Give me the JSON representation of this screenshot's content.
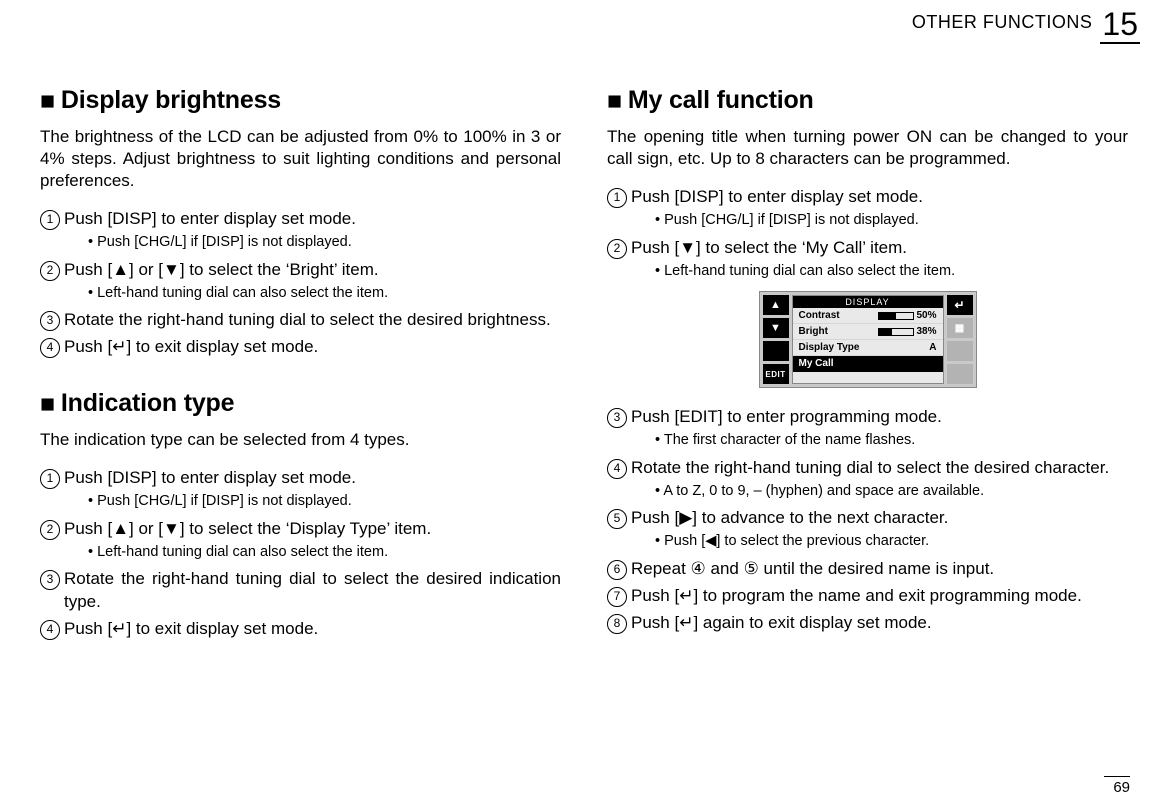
{
  "header": {
    "section_label": "OTHER FUNCTIONS",
    "chapter_number": "15"
  },
  "footer": {
    "page_number": "69"
  },
  "left": {
    "sect1_title": "Display brightness",
    "sect1_intro": "The brightness of the LCD can be adjusted from 0% to 100% in 3 or 4% steps. Adjust brightness to suit lighting conditions and personal preferences.",
    "s1_step1": "Push [DISP] to enter display set mode.",
    "s1_step1_note": "Push [CHG/L] if [DISP] is not displayed.",
    "s1_step2": "Push [▲] or [▼] to select the ‘Bright’ item.",
    "s1_step2_note": "Left-hand tuning dial can also select the item.",
    "s1_step3": "Rotate the right-hand tuning dial to select the desired brightness.",
    "s1_step4": "Push [↵] to exit display set mode.",
    "sect2_title": "Indication type",
    "sect2_intro": "The indication type can be selected from 4 types.",
    "s2_step1": "Push [DISP] to enter display set mode.",
    "s2_step1_note": "Push [CHG/L] if [DISP] is not displayed.",
    "s2_step2": "Push [▲] or [▼] to select the ‘Display Type’ item.",
    "s2_step2_note": "Left-hand tuning dial can also select the item.",
    "s2_step3": "Rotate the right-hand tuning dial to select the desired indication type.",
    "s2_step4": "Push [↵] to exit display set mode."
  },
  "right": {
    "sect3_title": "My call function",
    "sect3_intro": "The opening title when turning power ON can be changed to your call sign, etc. Up to 8 characters can be programmed.",
    "s3_step1": "Push [DISP] to enter display set mode.",
    "s3_step1_note": "Push [CHG/L] if [DISP] is not displayed.",
    "s3_step2": "Push [▼] to select the ‘My Call’ item.",
    "s3_step2_note": "Left-hand tuning dial can also select the item.",
    "s3_step3": "Push [EDIT] to enter programming mode.",
    "s3_step3_note": "The first character of the name flashes.",
    "s3_step4": "Rotate the right-hand tuning dial to select the desired character.",
    "s3_step4_note": "A to Z, 0 to 9, – (hyphen) and space are available.",
    "s3_step5": "Push [▶] to advance to the next character.",
    "s3_step5_note": "Push [◀] to select the previous character.",
    "s3_step6": "Repeat ④ and ⑤ until the desired name is input.",
    "s3_step7": "Push [↵] to program the name and exit programming mode.",
    "s3_step8": "Push [↵] again to exit display set mode."
  },
  "lcd": {
    "title": "DISPLAY",
    "row1_label": "Contrast",
    "row1_val": "50%",
    "row2_label": "Bright",
    "row2_val": "38%",
    "row3_label": "Display Type",
    "row3_val": "A",
    "row4_label": "My Call",
    "left_btn_up": "▲",
    "left_btn_down": "▼",
    "left_btn_edit": "EDIT",
    "right_btn_enter": "↵"
  },
  "nums": {
    "n1": "1",
    "n2": "2",
    "n3": "3",
    "n4": "4",
    "n5": "5",
    "n6": "6",
    "n7": "7",
    "n8": "8"
  }
}
